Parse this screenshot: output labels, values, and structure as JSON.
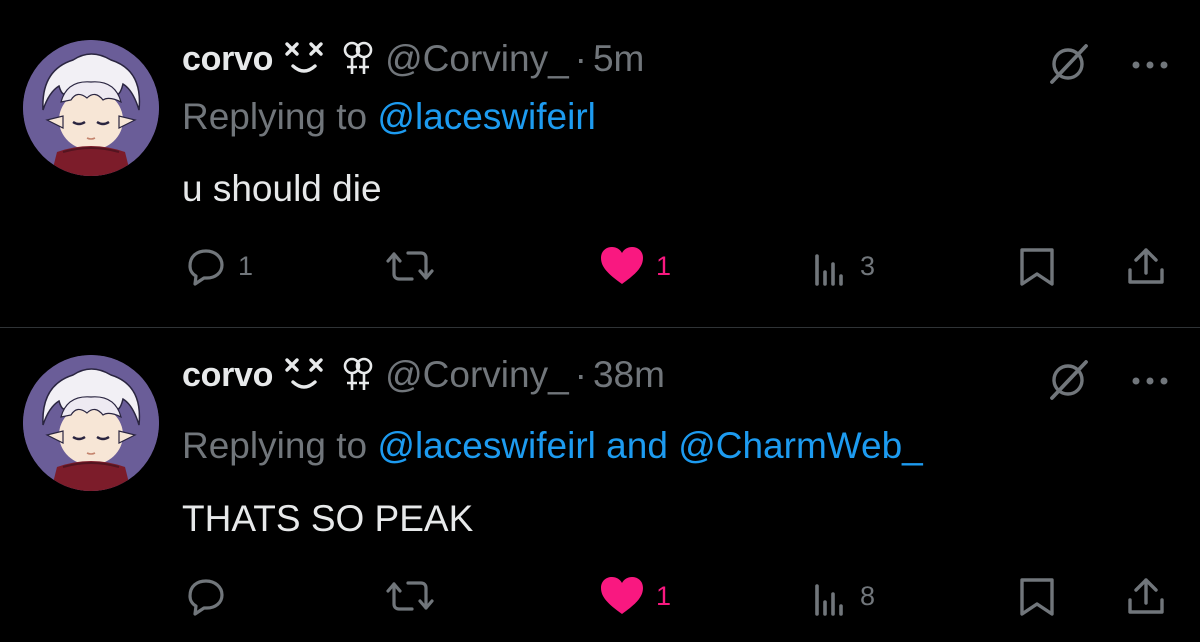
{
  "tweets": [
    {
      "display_name": "corvo",
      "emoji": "x-eyes-smile-emoji",
      "handle": "@Corviny_",
      "separator": "·",
      "time": "5m",
      "reply_prefix": "Replying to",
      "reply_mentions": [
        "@laceswifeirl"
      ],
      "reply_joiner": "",
      "text": "u should die",
      "replies": "1",
      "retweets": "",
      "likes": "1",
      "views": "3",
      "liked": true
    },
    {
      "display_name": "corvo",
      "emoji": "x-eyes-smile-emoji",
      "handle": "@Corviny_",
      "separator": "·",
      "time": "38m",
      "reply_prefix": "Replying to",
      "reply_mentions": [
        "@laceswifeirl",
        "@CharmWeb_"
      ],
      "reply_joiner": "and",
      "text": "THATS SO PEAK",
      "replies": "",
      "retweets": "",
      "likes": "1",
      "views": "8",
      "liked": true
    }
  ],
  "colors": {
    "background": "#000000",
    "text_primary": "#e7e9ea",
    "text_secondary": "#71767b",
    "link": "#1d9bf0",
    "like": "#f91880",
    "divider": "#2f3336",
    "avatar_bg": "#6a5d98"
  },
  "icons": {
    "gender": "lesbian-symbol-icon",
    "grok": "grok-icon",
    "more": "more-icon",
    "reply": "reply-icon",
    "retweet": "retweet-icon",
    "like": "heart-icon",
    "views": "views-icon",
    "bookmark": "bookmark-icon",
    "share": "share-icon"
  }
}
